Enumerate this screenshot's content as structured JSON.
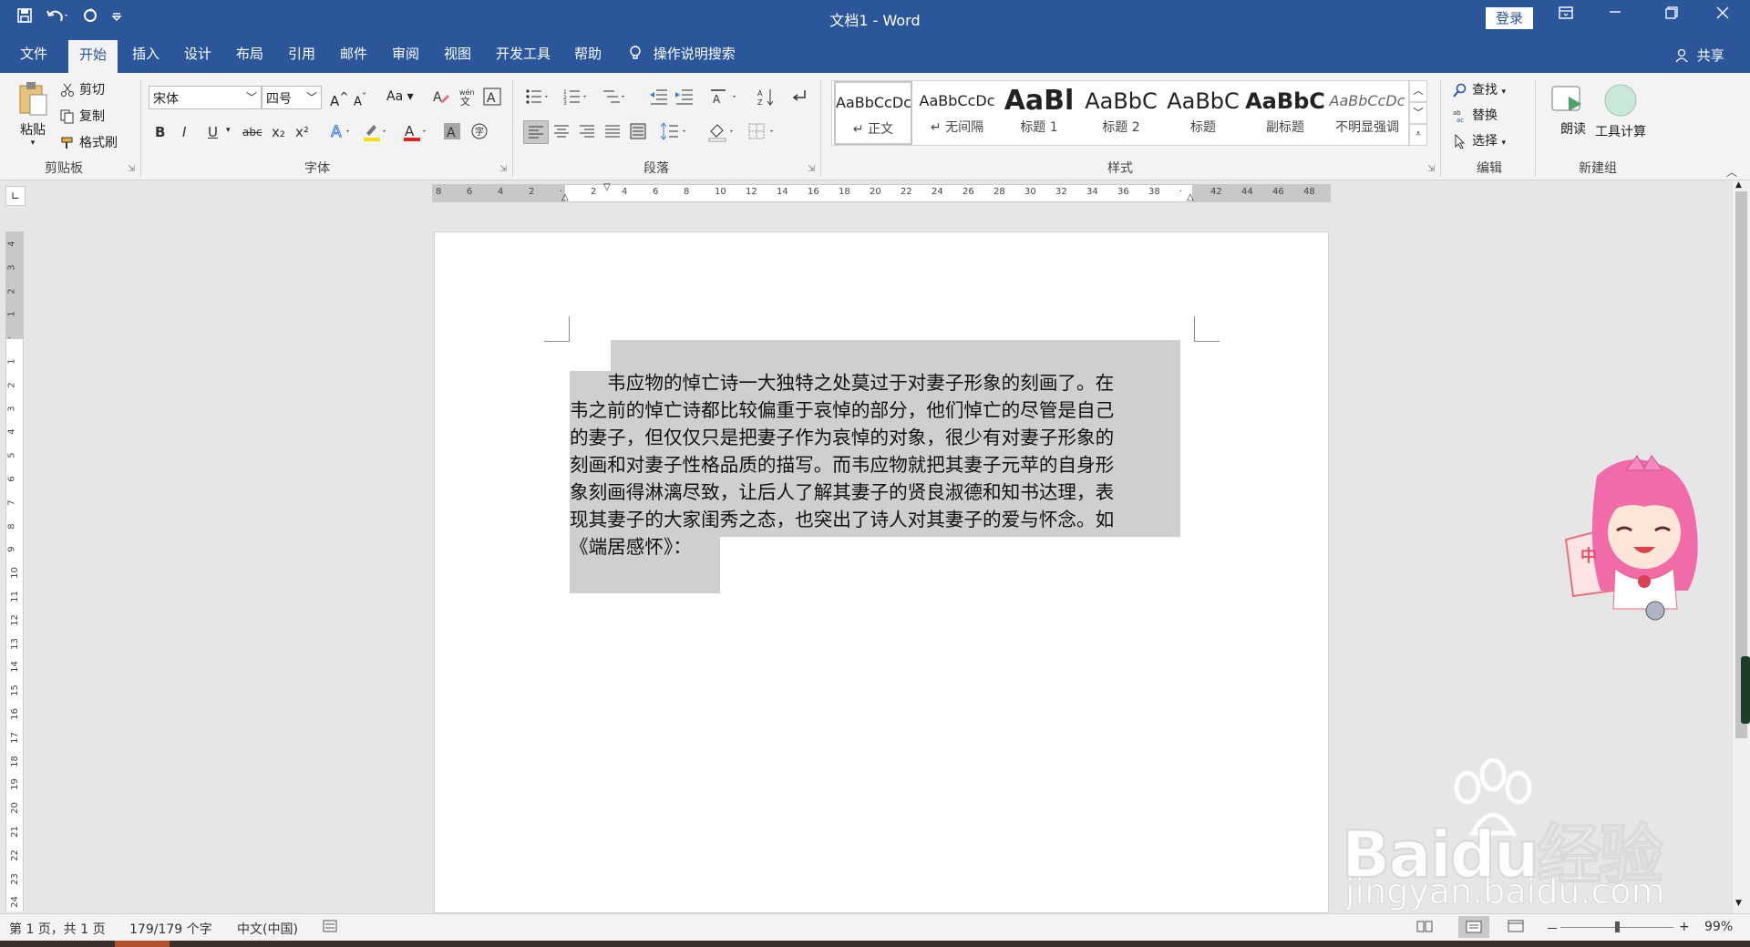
{
  "titlebar": {
    "title": "文档1 - Word",
    "login": "登录",
    "qat_icons": [
      "save-icon",
      "undo-icon",
      "redo-icon",
      "customize-qat-icon"
    ],
    "controls": [
      "ribbon-display-icon",
      "minimize-icon",
      "restore-icon",
      "close-icon"
    ]
  },
  "tabs": [
    "文件",
    "开始",
    "插入",
    "设计",
    "布局",
    "引用",
    "邮件",
    "审阅",
    "视图",
    "开发工具",
    "帮助"
  ],
  "active_tab": "开始",
  "tell_me": "操作说明搜索",
  "share": "共享",
  "clipboard": {
    "paste": "粘贴",
    "cut": "剪切",
    "copy": "复制",
    "format_painter": "格式刷",
    "label": "剪贴板"
  },
  "font": {
    "name": "宋体",
    "size": "四号",
    "case_btn": "Aa",
    "label": "字体",
    "bold": "B",
    "italic": "I",
    "underline": "U",
    "strike": "abc",
    "sub": "x₂",
    "sup": "x²"
  },
  "paragraph": {
    "label": "段落"
  },
  "styles": {
    "label": "样式",
    "items": [
      {
        "sample": "AaBbCcDc",
        "name": "↵ 正文"
      },
      {
        "sample": "AaBbCcDc",
        "name": "↵ 无间隔"
      },
      {
        "sample": "AaBl",
        "name": "标题 1"
      },
      {
        "sample": "AaBbC",
        "name": "标题 2"
      },
      {
        "sample": "AaBbC",
        "name": "标题"
      },
      {
        "sample": "AaBbC",
        "name": "副标题"
      },
      {
        "sample": "AaBbCcDc",
        "name": "不明显强调"
      }
    ]
  },
  "editing": {
    "find": "查找",
    "replace": "替换",
    "select": "选择",
    "label": "编辑"
  },
  "newgroup": {
    "read": "朗读",
    "calc": "工具计算",
    "label": "新建组"
  },
  "hruler_ticks": [
    "8",
    "6",
    "4",
    "2",
    "",
    "2",
    "4",
    "6",
    "8",
    "10",
    "12",
    "14",
    "16",
    "18",
    "20",
    "22",
    "24",
    "26",
    "28",
    "30",
    "32",
    "34",
    "36",
    "38",
    "",
    "42",
    "44",
    "46",
    "48"
  ],
  "vruler_ticks": [
    "4",
    "3",
    "2",
    "1",
    "",
    "1",
    "2",
    "3",
    "4",
    "5",
    "6",
    "7",
    "8",
    "9",
    "10",
    "11",
    "12",
    "13",
    "14",
    "15",
    "16",
    "17",
    "18",
    "19",
    "20",
    "21",
    "22",
    "23",
    "24"
  ],
  "document": {
    "lines": [
      "　　韦应物的悼亡诗一大独特之处莫过于对妻子形象的刻画了。在",
      "韦之前的悼亡诗都比较偏重于哀悼的部分，他们悼亡的尽管是自己",
      "的妻子，但仅仅只是把妻子作为哀悼的对象，很少有对妻子形象的",
      "刻画和对妻子性格品质的描写。而韦应物就把其妻子元苹的自身形",
      "象刻画得淋漓尽致，让后人了解其妻子的贤良淑德和知书达理，表",
      "现其妻子的大家闺秀之态，也突出了诗人对其妻子的爱与怀念。如",
      "《端居感怀》："
    ]
  },
  "status": {
    "page": "第 1 页，共 1 页",
    "words": "179/179 个字",
    "language": "中文(中国)",
    "zoom": "99%",
    "zoom_minus": "－",
    "zoom_plus": "+"
  },
  "watermark": {
    "brand": "Baidu经验",
    "url": "jingyan.baidu.com"
  },
  "mascot_text": "中",
  "colors": {
    "brand": "#2b579a",
    "selection": "#cfcfcf",
    "font_red": "#e02020",
    "highlight_yellow": "#f5e100"
  }
}
